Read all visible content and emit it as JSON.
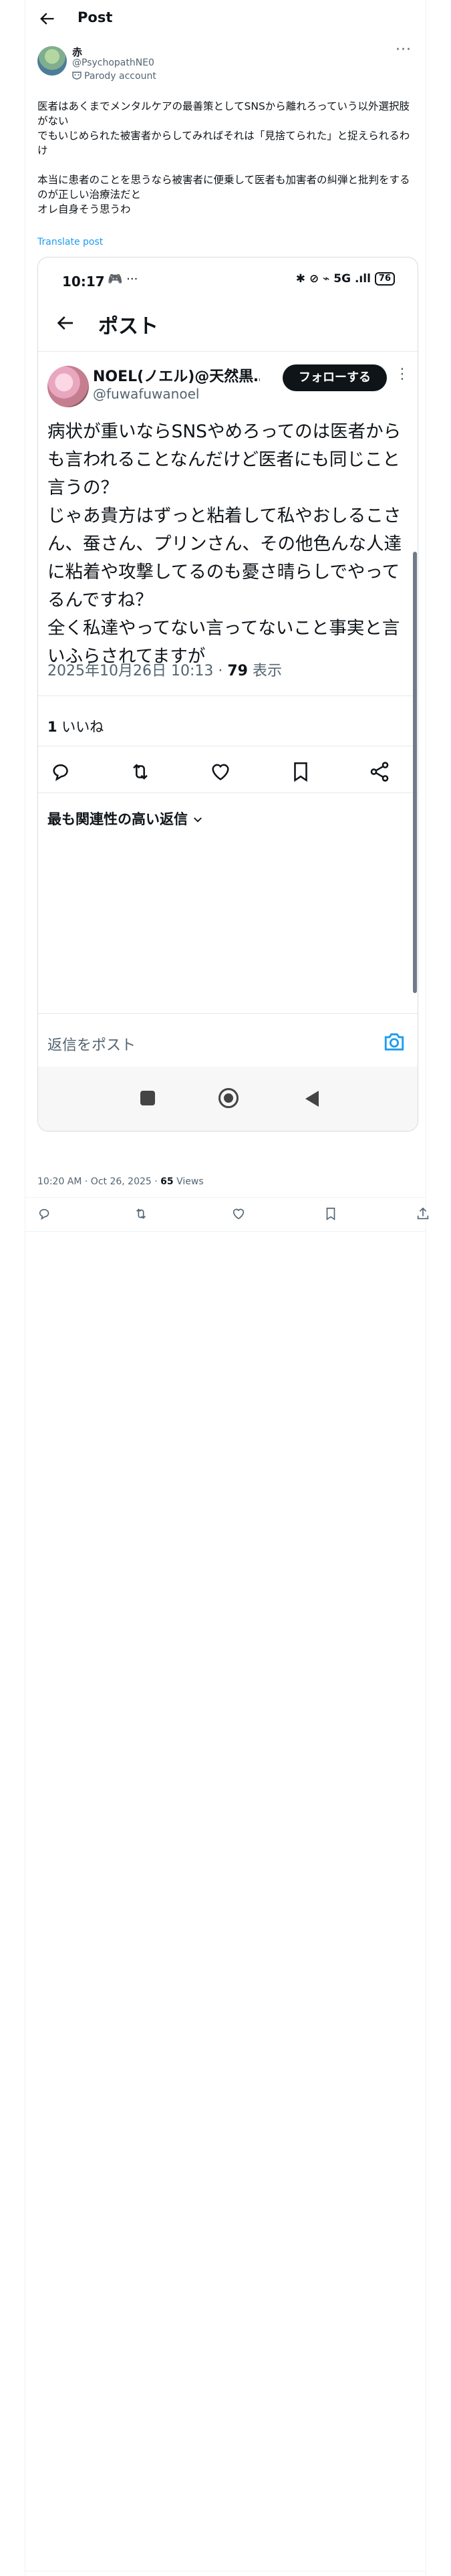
{
  "header": {
    "title": "Post",
    "back_icon": "arrow-left-icon",
    "more_icon": "more-horizontal-icon"
  },
  "author": {
    "name": "赤",
    "handle": "@PsychopathNE0",
    "label": "Parody account",
    "label_icon": "mask-icon"
  },
  "tweet": {
    "text": "医者はあくまでメンタルケアの最善策としてSNSから離れろっていう以外選択肢がない\nでもいじめられた被害者からしてみればそれは「見捨てられた」と捉えられるわけ\n\n本当に患者のことを思うなら被害者に便乗して医者も加害者の糾弾と批判をするのが正しい治療法だと\nオレ自身そう思うわ",
    "translate_label": "Translate post"
  },
  "embedded": {
    "status_time": "10:17",
    "status_left_icons": "🎮 ···",
    "status_right": "✱ ⊘ ⌁ 5G .ıll",
    "battery": "76",
    "title": "ポスト",
    "author_name": "NOEL(ノエル)@天然黒…",
    "author_handle": "@fuwafuwanoel",
    "follow_label": "フォローする",
    "text": "病状が重いならSNSやめろってのは医者からも言われることなんだけど医者にも同じこと言うの？\nじゃあ貴方はずっと粘着して私やおしるこさん、蚕さん、プリンさん、その他色んな人達に粘着や攻撃してるのも憂さ晴らしでやってるんですね？\n全く私達やってない言ってないこと事実と言いふらされてますが",
    "date": "2025年10月26日 10:13 · ",
    "views_count": "79",
    "views_label": " 表示",
    "likes_count": "1",
    "likes_label": " いいね",
    "relevant_label": "最も関連性の高い返信",
    "reply_placeholder": "返信をポスト",
    "actions": [
      "reply-icon",
      "repost-icon",
      "like-icon",
      "bookmark-icon",
      "share-icon"
    ]
  },
  "meta": {
    "time": "10:20 AM · Oct 26, 2025 · ",
    "views_count": "65",
    "views_label": " Views"
  },
  "actions": [
    "reply-icon",
    "repost-icon",
    "like-icon",
    "bookmark-icon",
    "share-icon"
  ],
  "colors": {
    "link": "#1d9bf0",
    "muted": "#536471",
    "text": "#0f1419",
    "border": "#eff3f4"
  }
}
